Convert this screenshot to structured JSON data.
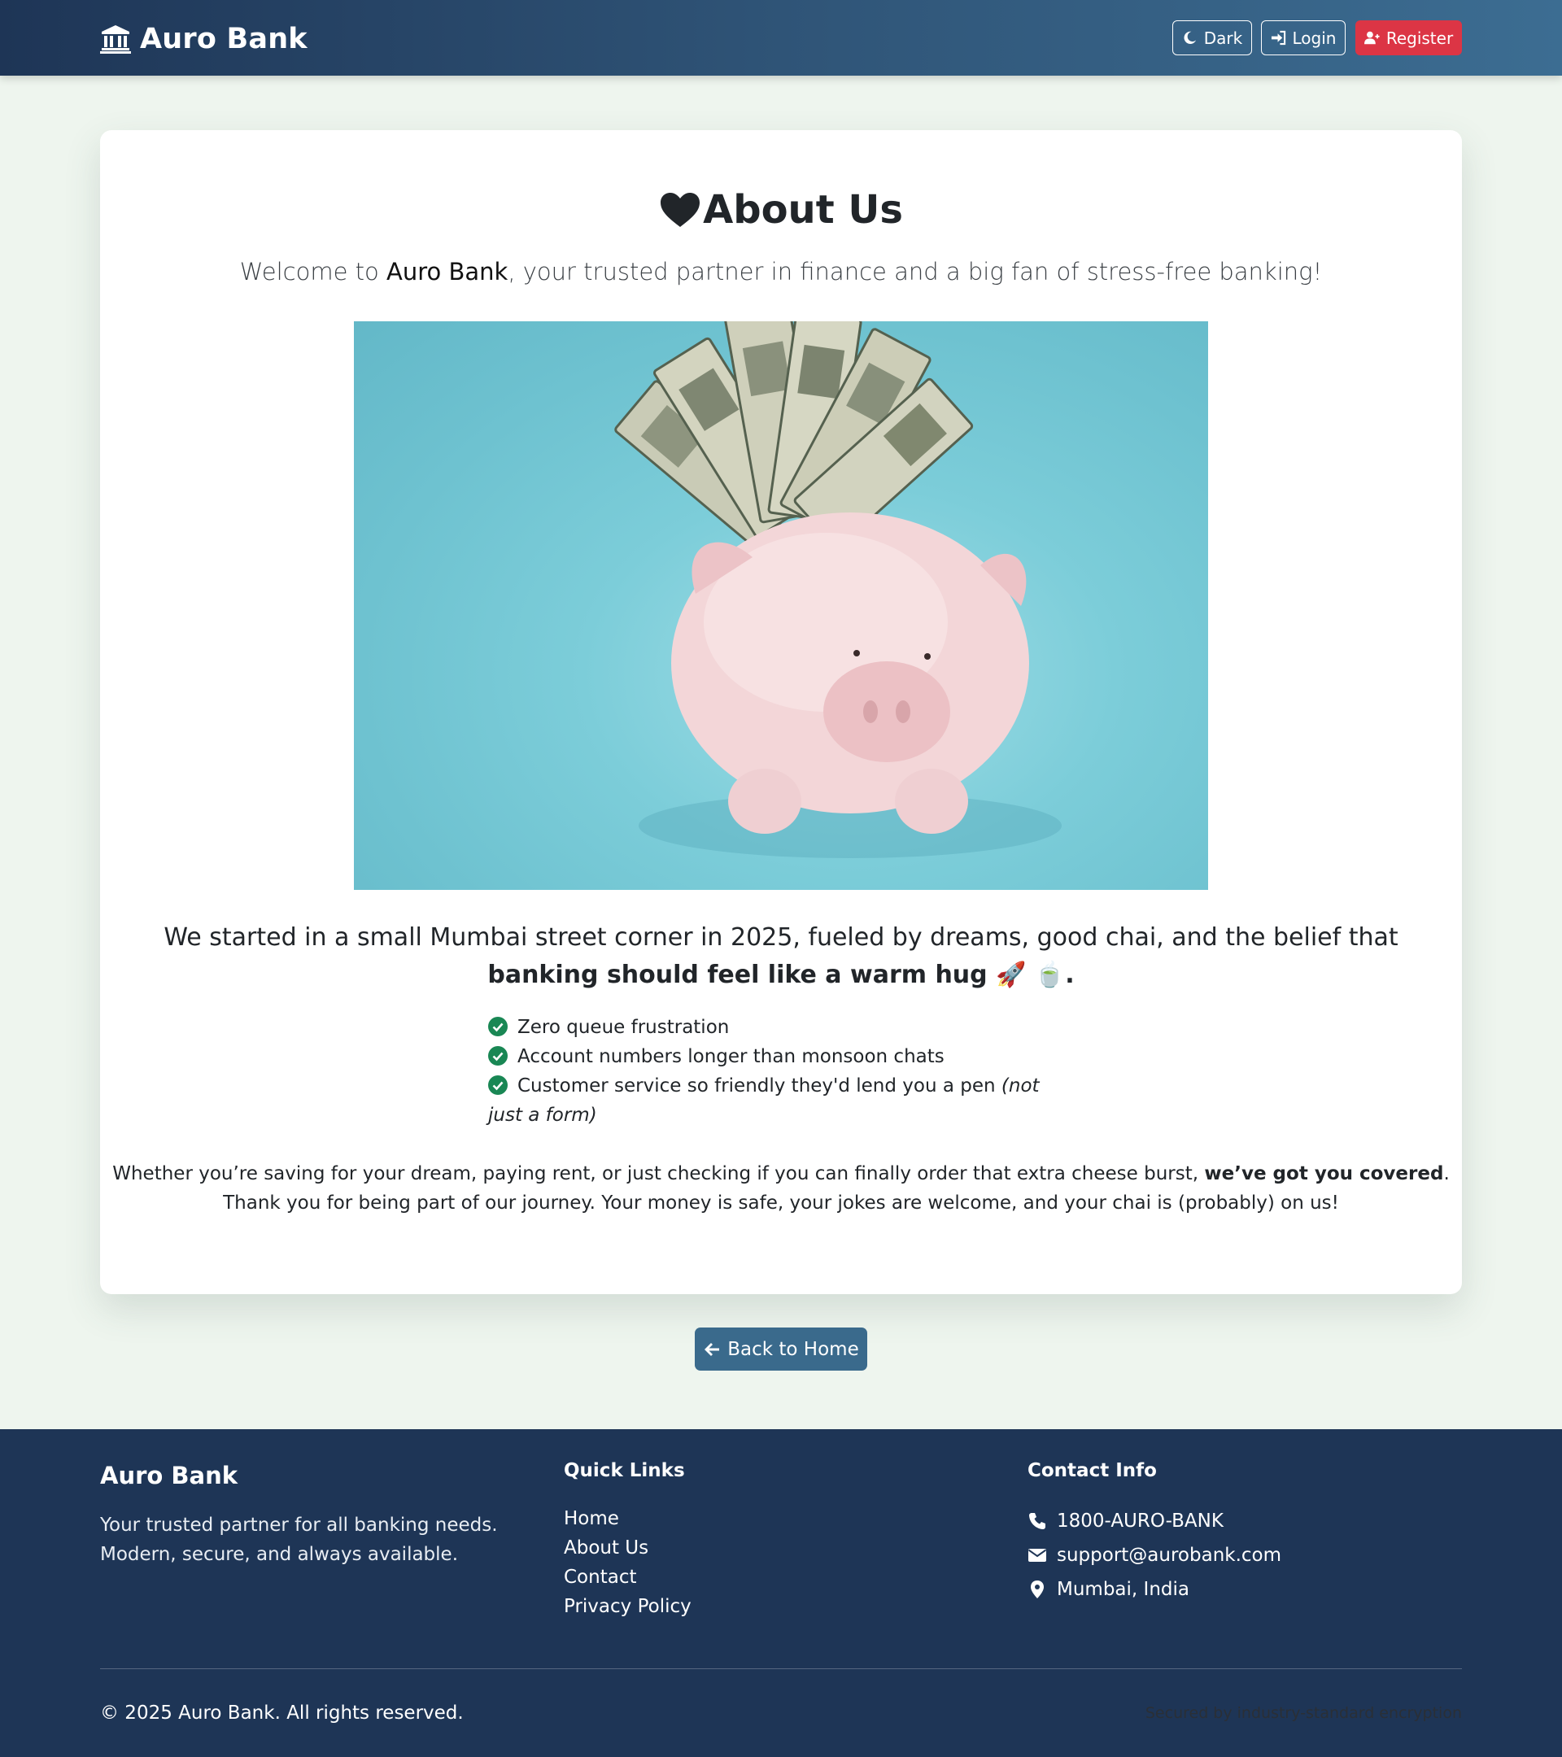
{
  "navbar": {
    "brand": "Auro Bank",
    "brand_icon": "bank-icon",
    "dark_label": "Dark",
    "login_label": "Login",
    "register_label": "Register"
  },
  "about": {
    "title": "About Us",
    "title_icon": "heart-icon",
    "lead_prefix": "Welcome to ",
    "lead_bank": "Auro Bank",
    "lead_suffix": ", your trusted partner in finance and a big fan of stress-free banking!",
    "image_subject": "piggy-bank-with-dollar-bills",
    "story_plain": "We started in a small Mumbai street corner in 2025, fueled by dreams, good chai, and the belief that ",
    "story_bold": "banking should feel like a warm hug 🚀 🍵.",
    "features": [
      "Zero queue frustration",
      "Account numbers longer than monsoon chats",
      "Customer service so friendly they'd lend you a pen "
    ],
    "feature_3_italic": "(not just a form)",
    "closing_line1_plain": "Whether you’re saving for your dream, paying rent, or just checking if you can finally order that extra cheese burst, ",
    "closing_line1_bold": "we’ve got you covered",
    "closing_line1_end": ".",
    "closing_line2": "Thank you for being part of our journey. Your money is safe, your jokes are welcome, and your chai is (probably) on us!",
    "back_label": "Back to Home"
  },
  "footer": {
    "brand_title": "Auro Bank",
    "brand_desc_1": "Your trusted partner for all banking needs.",
    "brand_desc_2": "Modern, secure, and always available.",
    "quick_links_heading": "Quick Links",
    "quick_links": [
      "Home",
      "About Us",
      "Contact",
      "Privacy Policy"
    ],
    "contact_heading": "Contact Info",
    "phone": "1800-AURO-BANK",
    "email": "support@aurobank.com",
    "location": "Mumbai, India",
    "copyright": "© 2025 Auro Bank. All rights reserved.",
    "secured": "Secured by industry-standard encryption"
  },
  "colors": {
    "navbar_start": "#1e3556",
    "navbar_end": "#3c6d92",
    "register": "#dc3545",
    "back_button": "#3a6a8c",
    "footer_bg": "#1e3556",
    "check": "#198754",
    "page_bg": "#eef5ee"
  }
}
